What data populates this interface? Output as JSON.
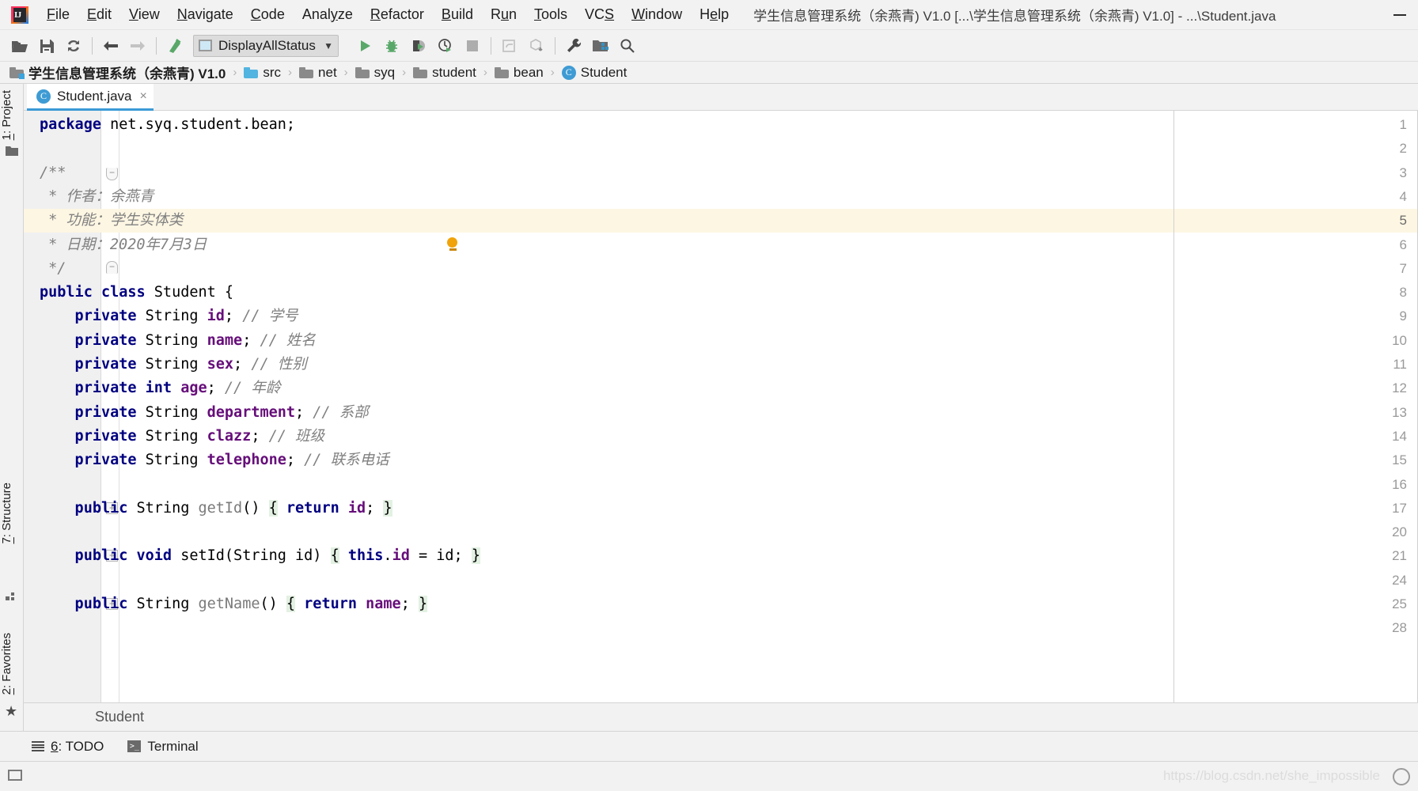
{
  "window": {
    "title": "学生信息管理系统（余燕青) V1.0 [...\\学生信息管理系统（余燕青) V1.0] - ...\\Student.java",
    "minimize_label": "minimize"
  },
  "menubar": {
    "logo_text": "IJ",
    "items": [
      {
        "pre": "",
        "mn": "F",
        "post": "ile"
      },
      {
        "pre": "",
        "mn": "E",
        "post": "dit"
      },
      {
        "pre": "",
        "mn": "V",
        "post": "iew"
      },
      {
        "pre": "",
        "mn": "N",
        "post": "avigate"
      },
      {
        "pre": "",
        "mn": "C",
        "post": "ode"
      },
      {
        "pre": "Anal",
        "mn": "y",
        "post": "ze"
      },
      {
        "pre": "",
        "mn": "R",
        "post": "efactor"
      },
      {
        "pre": "",
        "mn": "B",
        "post": "uild"
      },
      {
        "pre": "R",
        "mn": "u",
        "post": "n"
      },
      {
        "pre": "",
        "mn": "T",
        "post": "ools"
      },
      {
        "pre": "VC",
        "mn": "S",
        "post": ""
      },
      {
        "pre": "",
        "mn": "W",
        "post": "indow"
      },
      {
        "pre": "H",
        "mn": "e",
        "post": "lp"
      }
    ]
  },
  "toolbar": {
    "icons": [
      {
        "name": "open-folder-icon"
      },
      {
        "name": "save-all-icon"
      },
      {
        "name": "sync-refresh-icon"
      },
      {
        "name": "navigate-back-icon"
      },
      {
        "name": "navigate-forward-icon"
      },
      {
        "name": "compile-icon"
      }
    ],
    "run_config": {
      "label": "DisplayAllStatus",
      "arrow": "▼"
    },
    "run_icons": [
      {
        "name": "run-icon"
      },
      {
        "name": "debug-icon"
      },
      {
        "name": "run-with-coverage-icon"
      },
      {
        "name": "profile-icon"
      },
      {
        "name": "stop-icon"
      },
      {
        "name": "update-project-icon"
      },
      {
        "name": "commit-icon"
      },
      {
        "name": "settings-wrench-icon"
      },
      {
        "name": "project-structure-icon"
      },
      {
        "name": "search-everywhere-icon"
      }
    ]
  },
  "breadcrumb": {
    "items": [
      {
        "label": "学生信息管理系统（余燕青) V1.0",
        "icon": "project-folder-icon",
        "type": "project"
      },
      {
        "label": "src",
        "icon": "source-folder-icon",
        "type": "source"
      },
      {
        "label": "net",
        "icon": "package-folder-icon",
        "type": "folder"
      },
      {
        "label": "syq",
        "icon": "package-folder-icon",
        "type": "folder"
      },
      {
        "label": "student",
        "icon": "package-folder-icon",
        "type": "folder"
      },
      {
        "label": "bean",
        "icon": "package-folder-icon",
        "type": "folder"
      },
      {
        "label": "Student",
        "icon": "java-class-icon",
        "type": "class"
      }
    ],
    "separator": "›"
  },
  "left_strip": {
    "tabs": [
      {
        "num": "1",
        "label": ": Project",
        "icon": "project-folder-icon"
      },
      {
        "num": "7",
        "label": ": Structure",
        "icon": "structure-icon"
      },
      {
        "num": "2",
        "label": ": Favorites",
        "icon": "star-icon"
      }
    ]
  },
  "editor_tab": {
    "label": "Student.java",
    "icon_letter": "C",
    "close": "×"
  },
  "editor": {
    "highlighted_line": 5,
    "lines": [
      {
        "num": "1",
        "fold": "",
        "tokens": [
          {
            "t": "package ",
            "c": "kw"
          },
          {
            "t": "net.syq.student.bean;",
            "c": "plain"
          }
        ]
      },
      {
        "num": "2",
        "fold": "",
        "tokens": []
      },
      {
        "num": "3",
        "fold": "open",
        "tokens": [
          {
            "t": "/**",
            "c": "cmt"
          }
        ]
      },
      {
        "num": "4",
        "fold": "",
        "tokens": [
          {
            "t": " * 作者：余燕青",
            "c": "cmt"
          }
        ]
      },
      {
        "num": "5",
        "fold": "",
        "tokens": [
          {
            "t": " * 功能：学生实体类",
            "c": "cmt"
          }
        ]
      },
      {
        "num": "6",
        "fold": "",
        "tokens": [
          {
            "t": " * 日期：2020年7月3日",
            "c": "cmt"
          }
        ]
      },
      {
        "num": "7",
        "fold": "close",
        "tokens": [
          {
            "t": " */",
            "c": "cmt"
          }
        ]
      },
      {
        "num": "8",
        "fold": "",
        "tokens": [
          {
            "t": "public class ",
            "c": "kw"
          },
          {
            "t": "Student {",
            "c": "plain"
          }
        ]
      },
      {
        "num": "9",
        "fold": "",
        "tokens": [
          {
            "t": "    private ",
            "c": "kw"
          },
          {
            "t": "String ",
            "c": "plain"
          },
          {
            "t": "id",
            "c": "fld"
          },
          {
            "t": "; ",
            "c": "plain"
          },
          {
            "t": "// 学号",
            "c": "cmt"
          }
        ]
      },
      {
        "num": "10",
        "fold": "",
        "tokens": [
          {
            "t": "    private ",
            "c": "kw"
          },
          {
            "t": "String ",
            "c": "plain"
          },
          {
            "t": "name",
            "c": "fld"
          },
          {
            "t": "; ",
            "c": "plain"
          },
          {
            "t": "// 姓名",
            "c": "cmt"
          }
        ]
      },
      {
        "num": "11",
        "fold": "",
        "tokens": [
          {
            "t": "    private ",
            "c": "kw"
          },
          {
            "t": "String ",
            "c": "plain"
          },
          {
            "t": "sex",
            "c": "fld"
          },
          {
            "t": "; ",
            "c": "plain"
          },
          {
            "t": "// 性别",
            "c": "cmt"
          }
        ]
      },
      {
        "num": "12",
        "fold": "",
        "tokens": [
          {
            "t": "    private int ",
            "c": "kw"
          },
          {
            "t": "age",
            "c": "fld"
          },
          {
            "t": "; ",
            "c": "plain"
          },
          {
            "t": "// 年龄",
            "c": "cmt"
          }
        ]
      },
      {
        "num": "13",
        "fold": "",
        "tokens": [
          {
            "t": "    private ",
            "c": "kw"
          },
          {
            "t": "String ",
            "c": "plain"
          },
          {
            "t": "department",
            "c": "fld"
          },
          {
            "t": "; ",
            "c": "plain"
          },
          {
            "t": "// 系部",
            "c": "cmt"
          }
        ]
      },
      {
        "num": "14",
        "fold": "",
        "tokens": [
          {
            "t": "    private ",
            "c": "kw"
          },
          {
            "t": "String ",
            "c": "plain"
          },
          {
            "t": "clazz",
            "c": "fld"
          },
          {
            "t": "; ",
            "c": "plain"
          },
          {
            "t": "// 班级",
            "c": "cmt"
          }
        ]
      },
      {
        "num": "15",
        "fold": "",
        "tokens": [
          {
            "t": "    private ",
            "c": "kw"
          },
          {
            "t": "String ",
            "c": "plain"
          },
          {
            "t": "telephone",
            "c": "fld"
          },
          {
            "t": "; ",
            "c": "plain"
          },
          {
            "t": "// 联系电话",
            "c": "cmt"
          }
        ]
      },
      {
        "num": "16",
        "fold": "",
        "tokens": []
      },
      {
        "num": "17",
        "fold": "plus",
        "tokens": [
          {
            "t": "    public ",
            "c": "kw"
          },
          {
            "t": "String ",
            "c": "plain"
          },
          {
            "t": "getId",
            "c": "mth"
          },
          {
            "t": "() ",
            "c": "plain"
          },
          {
            "t": "{",
            "c": "brc"
          },
          {
            "t": " ",
            "c": "plain"
          },
          {
            "t": "return ",
            "c": "kw"
          },
          {
            "t": "id",
            "c": "fld"
          },
          {
            "t": "; ",
            "c": "plain"
          },
          {
            "t": "}",
            "c": "brc"
          }
        ]
      },
      {
        "num": "20",
        "fold": "",
        "tokens": []
      },
      {
        "num": "21",
        "fold": "plus",
        "tokens": [
          {
            "t": "    public void ",
            "c": "kw"
          },
          {
            "t": "setId",
            "c": "plain"
          },
          {
            "t": "(String id) ",
            "c": "plain"
          },
          {
            "t": "{",
            "c": "brc"
          },
          {
            "t": " ",
            "c": "plain"
          },
          {
            "t": "this",
            "c": "kw"
          },
          {
            "t": ".",
            "c": "plain"
          },
          {
            "t": "id",
            "c": "fld"
          },
          {
            "t": " = id; ",
            "c": "plain"
          },
          {
            "t": "}",
            "c": "brc"
          }
        ]
      },
      {
        "num": "24",
        "fold": "",
        "tokens": []
      },
      {
        "num": "25",
        "fold": "plus",
        "tokens": [
          {
            "t": "    public ",
            "c": "kw"
          },
          {
            "t": "String ",
            "c": "plain"
          },
          {
            "t": "getName",
            "c": "mth"
          },
          {
            "t": "() ",
            "c": "plain"
          },
          {
            "t": "{",
            "c": "brc"
          },
          {
            "t": " ",
            "c": "plain"
          },
          {
            "t": "return ",
            "c": "kw"
          },
          {
            "t": "name",
            "c": "fld"
          },
          {
            "t": "; ",
            "c": "plain"
          },
          {
            "t": "}",
            "c": "brc"
          }
        ]
      },
      {
        "num": "28",
        "fold": "",
        "tokens": []
      }
    ],
    "intention_bulb": {
      "line": 6,
      "name": "intention-bulb-icon"
    }
  },
  "bottom_breadcrumb": {
    "label": "Student"
  },
  "statusbar": {
    "items": [
      {
        "num": "6",
        "label": ": TODO",
        "icon": "todo-list-icon"
      },
      {
        "num": "",
        "label": "Terminal",
        "icon": "terminal-icon"
      }
    ]
  },
  "footer": {
    "watermark": "https://blog.csdn.net/she_impossible"
  },
  "colors": {
    "accent": "#3c9ad6",
    "keyword": "#000080",
    "field": "#660e7a",
    "comment": "#808080",
    "method": "#7a7a7a",
    "brace_bg": "#e3f1e3",
    "highlight_row": "#fdf6e3",
    "chrome": "#f2f2f2",
    "run_green": "#3f9c35"
  }
}
